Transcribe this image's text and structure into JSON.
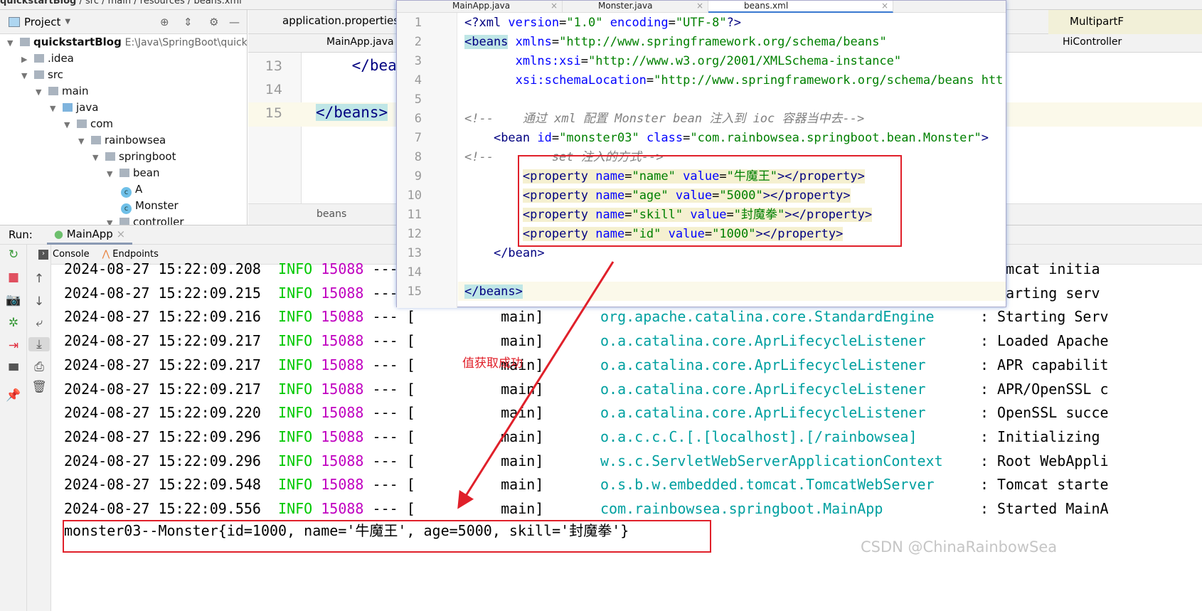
{
  "breadcrumb": [
    "quickstartBlog",
    "src",
    "main",
    "resources",
    "beans.xml"
  ],
  "project": {
    "title": "Project",
    "root": "quickstartBlog",
    "root_path": "E:\\Java\\SpringBoot\\quickstar",
    "items": [
      {
        "label": ".idea",
        "depth": 1,
        "kind": "folder",
        "open": false
      },
      {
        "label": "src",
        "depth": 1,
        "kind": "folder",
        "open": true
      },
      {
        "label": "main",
        "depth": 2,
        "kind": "folder",
        "open": true
      },
      {
        "label": "java",
        "depth": 3,
        "kind": "folder-blue",
        "open": true
      },
      {
        "label": "com",
        "depth": 4,
        "kind": "folder",
        "open": true
      },
      {
        "label": "rainbowsea",
        "depth": 5,
        "kind": "folder",
        "open": true
      },
      {
        "label": "springboot",
        "depth": 6,
        "kind": "folder",
        "open": true
      },
      {
        "label": "bean",
        "depth": 7,
        "kind": "folder",
        "open": true
      },
      {
        "label": "A",
        "depth": 8,
        "kind": "class"
      },
      {
        "label": "Monster",
        "depth": 8,
        "kind": "class"
      },
      {
        "label": "controller",
        "depth": 7,
        "kind": "folder",
        "open": true
      }
    ]
  },
  "bg_editor": {
    "tab1": "application.properties",
    "tab2": "MainApp.java",
    "tab_right1": "MultipartF",
    "tab_right2": "HiController",
    "lines": [
      {
        "n": "13",
        "text": "    </beans"
      },
      {
        "n": "14",
        "text": ""
      },
      {
        "n": "15",
        "text": "</beans>"
      }
    ],
    "footer": "beans"
  },
  "popup": {
    "tabs": [
      {
        "label": "MainApp.java"
      },
      {
        "label": "Monster.java"
      },
      {
        "label": "beans.xml",
        "active": true
      }
    ],
    "lines": [
      {
        "n": "1",
        "html": "<span class='tg'>&lt;?xml </span><span class='at'>version</span>=<span class='st'>\"1.0\"</span> <span class='at'>encoding</span>=<span class='st'>\"UTF-8\"</span><span class='tg'>?&gt;</span>"
      },
      {
        "n": "2",
        "html": "<span class='tg' style='background:#bfe6e6'>&lt;beans</span> <span class='at'>xmlns</span>=<span class='st'>\"http://www.springframework.org/schema/beans\"</span>"
      },
      {
        "n": "3",
        "html": "       <span class='at'>xmlns:xsi</span>=<span class='st'>\"http://www.w3.org/2001/XMLSchema-instance\"</span>"
      },
      {
        "n": "4",
        "html": "       <span class='at'>xsi:schemaLocation</span>=<span class='st'>\"http://www.springframework.org/schema/beans htt</span>"
      },
      {
        "n": "5",
        "html": ""
      },
      {
        "n": "6",
        "html": "<span class='cm'>&lt;!--    通过 xml 配置 Monster bean 注入到 ioc 容器当中去--&gt;</span>"
      },
      {
        "n": "7",
        "html": "    <span class='tg'>&lt;bean </span><span class='at'>id</span>=<span class='st'>\"monster03\"</span> <span class='at'>class</span>=<span class='st'>\"com.rainbowsea.springboot.bean.Monster\"</span><span class='tg'>&gt;</span>"
      },
      {
        "n": "8",
        "html": "<span class='cm'>&lt;!--        set 注入的方式--&gt;</span>"
      },
      {
        "n": "9",
        "html": "        <span class='hl'><span class='tg'>&lt;property </span><span class='at'>name</span>=<span class='st'>\"name\"</span> <span class='at'>value</span>=<span class='st'>\"牛魔王\"</span><span class='tg'>&gt;&lt;/property&gt;</span></span>"
      },
      {
        "n": "10",
        "html": "        <span class='hl'><span class='tg'>&lt;property </span><span class='at'>name</span>=<span class='st'>\"age\"</span> <span class='at'>value</span>=<span class='st'>\"5000\"</span><span class='tg'>&gt;&lt;/property&gt;</span></span>"
      },
      {
        "n": "11",
        "html": "        <span class='hl'><span class='tg'>&lt;property </span><span class='at'>name</span>=<span class='st'>\"skill\"</span> <span class='at'>value</span>=<span class='st'>\"封魔拳\"</span><span class='tg'>&gt;&lt;/property&gt;</span></span>"
      },
      {
        "n": "12",
        "html": "        <span class='hl'><span class='tg'>&lt;property </span><span class='at'>name</span>=<span class='st'>\"id\"</span> <span class='at'>value</span>=<span class='st'>\"1000\"</span><span class='tg'>&gt;&lt;/property&gt;</span></span>"
      },
      {
        "n": "13",
        "html": "    <span class='tg'>&lt;/bean&gt;</span>"
      },
      {
        "n": "14",
        "html": ""
      },
      {
        "n": "15",
        "html": "<span class='tg' style='background:#bfe6e6'>&lt;/beans&gt;</span>"
      }
    ]
  },
  "run": {
    "label": "Run:",
    "config": "MainApp",
    "console_tab": "Console",
    "endpoints_tab": "Endpoints"
  },
  "console": [
    {
      "ts": "2024-08-27 15:22:09.208",
      "level": "INFO",
      "pid": "15088",
      "logger": "",
      "msg": "Tomcat initia"
    },
    {
      "ts": "2024-08-27 15:22:09.215",
      "level": "INFO",
      "pid": "15088",
      "logger": "",
      "msg": "Starting serv"
    },
    {
      "ts": "2024-08-27 15:22:09.216",
      "level": "INFO",
      "pid": "15088",
      "thread": "main",
      "logger": "org.apache.catalina.core.StandardEngine",
      "msg": "Starting Serv"
    },
    {
      "ts": "2024-08-27 15:22:09.217",
      "level": "INFO",
      "pid": "15088",
      "thread": "main",
      "logger": "o.a.catalina.core.AprLifecycleListener",
      "msg": "Loaded Apache"
    },
    {
      "ts": "2024-08-27 15:22:09.217",
      "level": "INFO",
      "pid": "15088",
      "thread": "main",
      "logger": "o.a.catalina.core.AprLifecycleListener",
      "msg": "APR capabilit"
    },
    {
      "ts": "2024-08-27 15:22:09.217",
      "level": "INFO",
      "pid": "15088",
      "thread": "main",
      "logger": "o.a.catalina.core.AprLifecycleListener",
      "msg": "APR/OpenSSL c"
    },
    {
      "ts": "2024-08-27 15:22:09.220",
      "level": "INFO",
      "pid": "15088",
      "thread": "main",
      "logger": "o.a.catalina.core.AprLifecycleListener",
      "msg": "OpenSSL succe"
    },
    {
      "ts": "2024-08-27 15:22:09.296",
      "level": "INFO",
      "pid": "15088",
      "thread": "main",
      "logger": "o.a.c.c.C.[.[localhost].[/rainbowsea]",
      "msg": "Initializing"
    },
    {
      "ts": "2024-08-27 15:22:09.296",
      "level": "INFO",
      "pid": "15088",
      "thread": "main",
      "logger": "w.s.c.ServletWebServerApplicationContext",
      "msg": "Root WebAppli"
    },
    {
      "ts": "2024-08-27 15:22:09.548",
      "level": "INFO",
      "pid": "15088",
      "thread": "main",
      "logger": "o.s.b.w.embedded.tomcat.TomcatWebServer",
      "msg": "Tomcat starte"
    },
    {
      "ts": "2024-08-27 15:22:09.556",
      "level": "INFO",
      "pid": "15088",
      "thread": "main",
      "logger": "com.rainbowsea.springboot.MainApp",
      "msg": "Started MainA"
    }
  ],
  "output_line": "monster03--Monster{id=1000, name='牛魔王', age=5000, skill='封魔拳'}",
  "annotation": "值获取成功",
  "watermark": "CSDN @ChinaRainbowSea",
  "colors": {
    "annotation_red": "#e0202a",
    "info_green": "#00c800",
    "pid_magenta": "#c000c0",
    "logger_teal": "#00a0a0"
  }
}
